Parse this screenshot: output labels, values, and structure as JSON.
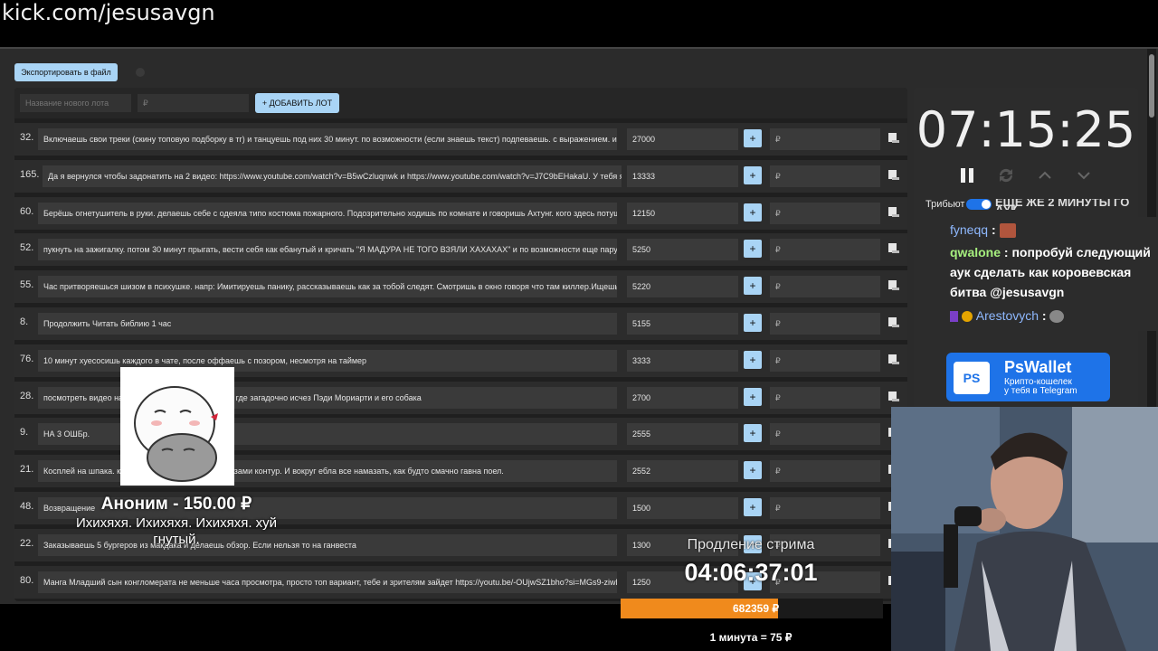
{
  "browser": {
    "url": "kick.com/jesusavgn"
  },
  "toolbar": {
    "export_label": "Экспортировать в файл"
  },
  "new_lot": {
    "name_placeholder": "Название нового лота",
    "price_placeholder": "₽",
    "add_label": "+ ДОБАВИТЬ ЛОТ"
  },
  "lots": [
    {
      "num": "32.",
      "title": "Включаешь свои треки (скину топовую подборку в тг) и танцуешь под них 30 минут. по возможности (если знаешь текст) подпеваешь. с выражением. и и",
      "amount": "27000",
      "plus": "+",
      "rub": "₽"
    },
    {
      "num": "165.",
      "title": "Да я вернулся чтобы задонатить на 2 видео: https://www.youtube.com/watch?v=B5wCzluqnwk и https://www.youtube.com/watch?v=J7C9bEHakaU. У тебя я",
      "amount": "13333",
      "plus": "+",
      "rub": "₽"
    },
    {
      "num": "60.",
      "title": "Берёшь огнетушитель в руки. делаешь себе с одеяла типо костюма пожарного. Подозрительно ходишь по комнате и говоришь Ахтунг. кого здесь потуш",
      "amount": "12150",
      "plus": "+",
      "rub": "₽"
    },
    {
      "num": "52.",
      "title": "пукнуть на зажигалку. потом 30 минут прыгать, вести себя как ебанутый и кричать \"Я МАДУРА НЕ ТОГО ВЗЯЛИ ХАХАХАХ\" и по возможности еще пару р",
      "amount": "5250",
      "plus": "+",
      "rub": "₽"
    },
    {
      "num": "55.",
      "title": "Час притворяешься шизом в психушке. напр: Имитируешь панику, рассказываешь как за тобой следят. Смотришь в окно говоря что там киллер.Ищешь с",
      "amount": "5220",
      "plus": "+",
      "rub": "₽"
    },
    {
      "num": "8.",
      "title": "Продолжить Читать библию 1 час",
      "amount": "5155",
      "plus": "+",
      "rub": "₽"
    },
    {
      "num": "76.",
      "title": "10 минут хуесосишь каждого в чате, после оффаешь с позором, несмотря на таймер",
      "amount": "3333",
      "plus": "+",
      "rub": "₽"
    },
    {
      "num": "28.",
      "title": "посмотреть видео на                         с населением из 11 человек, где загадочно исчез Пэди Мориарти и его собака",
      "amount": "2700",
      "plus": "+",
      "rub": "₽"
    },
    {
      "num": "9.",
      "title": "НА 3 ОШБр.",
      "amount": "2555",
      "plus": "+",
      "rub": "₽"
    },
    {
      "num": "21.",
      "title": "Косплей на шпака.                               кой над бровями, веко, под глазами контур. И вокруг ебла все намазать, как будто смачно гавна поел.",
      "amount": "2552",
      "plus": "+",
      "rub": "₽"
    },
    {
      "num": "48.",
      "title": "Возвращение",
      "amount": "1500",
      "plus": "+",
      "rub": "₽"
    },
    {
      "num": "22.",
      "title": "Заказываешь 5 бургеров из макдака и делаешь обзор. Если нельзя то на ганвеста",
      "amount": "1300",
      "plus": "+",
      "rub": "₽"
    },
    {
      "num": "80.",
      "title": "Манга Младший сын конгломерата не меньше часа просмотра, просто топ вариант, тебе и зрителям зайдет https://youtu.be/-OUjwSZ1bho?si=MGs9-ziwl",
      "amount": "1250",
      "plus": "+",
      "rub": "₽"
    }
  ],
  "timer": {
    "value": "07:15:25",
    "tribute_label": "Трибьют",
    "chat_header": "ЕЩЁ ЖЕ 2 МИНУТЫ ГО АУК"
  },
  "chat": {
    "line1_user": "fyneqq",
    "line2_user": "qwalone",
    "line2_msg": "попробуй следующий",
    "line3": "аук сделать как коровевская",
    "line4": "битва @jesusavgn",
    "line5_user": "Arestovych",
    "sep": ":"
  },
  "ad": {
    "logo": "PS",
    "title": "PsWallet",
    "sub1": "Крипто-кошелек",
    "sub2": "у тебя в Telegram"
  },
  "donation": {
    "title": "Аноним - 150.00 ₽",
    "message": "Ихихяхя. Ихихяхя. Ихихяхя. хуй гнутый."
  },
  "extension": {
    "title": "Продление стрима",
    "time": "04:06:37:01",
    "progress_value": "682359 ₽",
    "progress_fraction": 0.6,
    "rate": "1 минута = 75 ₽"
  },
  "colors": {
    "accent": "#a9d4f5",
    "orange": "#f08a1c",
    "blue": "#1e73e8"
  }
}
